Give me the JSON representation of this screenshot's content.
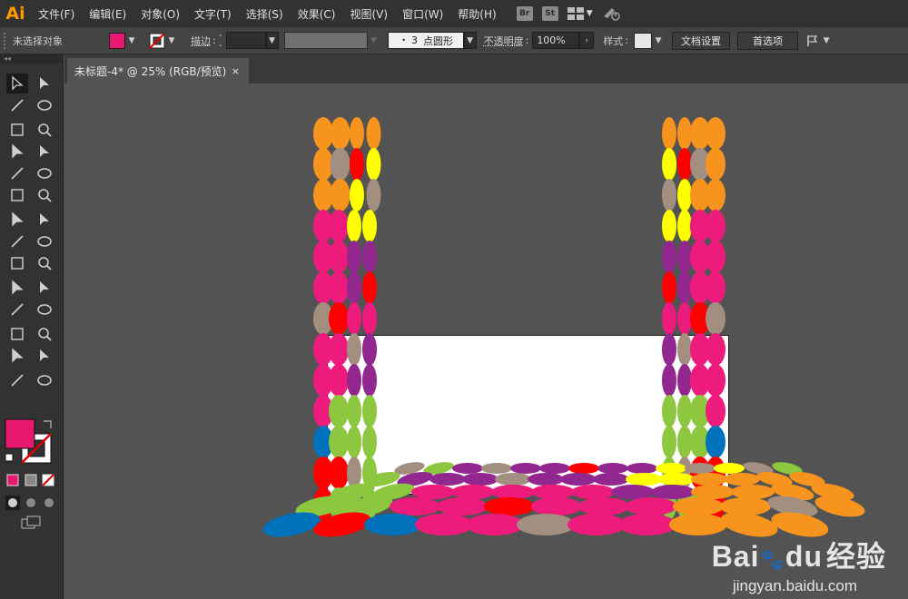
{
  "app": {
    "logo": "Ai"
  },
  "menu": [
    "文件(F)",
    "编辑(E)",
    "对象(O)",
    "文字(T)",
    "选择(S)",
    "效果(C)",
    "视图(V)",
    "窗口(W)",
    "帮助(H)"
  ],
  "menu_badges": {
    "bridge": "Br",
    "stock": "St"
  },
  "control": {
    "selection_status": "未选择对象",
    "fill_color": "#e8176f",
    "stroke_label": "描边",
    "brush_size": "3",
    "brush_name": "点圆形",
    "opacity_label": "不透明度",
    "opacity_value": "100%",
    "style_label": "样式",
    "doc_setup": "文档设置",
    "preferences": "首选项"
  },
  "toolbox": {
    "fill_color": "#e8176f",
    "tools": [
      "selection-tool",
      "direct-selection-tool",
      "magic-wand-tool",
      "lasso-tool",
      "pen-tool",
      "curvature-tool",
      "type-tool",
      "line-tool",
      "ellipse-tool",
      "paintbrush-tool",
      "shaper-tool",
      "scissors-tool",
      "rotate-tool",
      "scale-tool",
      "warp-tool",
      "free-transform-tool",
      "shape-builder-tool",
      "perspective-tool",
      "mesh-tool",
      "gradient-tool",
      "eyedropper-tool",
      "blend-tool",
      "symbol-sprayer-tool",
      "graph-tool",
      "artboard-tool",
      "slice-tool",
      "hand-tool",
      "zoom-tool"
    ]
  },
  "document": {
    "tab_title": "未标题-4* @ 25% (RGB/预览)",
    "close": "×"
  },
  "colors": {
    "orange": "#f7941d",
    "yellow": "#ffff00",
    "red": "#ff0000",
    "taupe": "#a38f80",
    "pink": "#ec1b7c",
    "purple": "#92278f",
    "green": "#8dc63f",
    "blue": "#0072bc"
  },
  "watermark": {
    "brand": "Bai",
    "brand_suffix": "du",
    "brand_cn": "经验",
    "url": "jingyan.baidu.com"
  }
}
